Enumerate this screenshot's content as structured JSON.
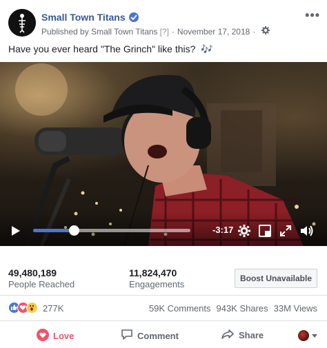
{
  "post": {
    "page_name": "Small Town Titans",
    "published_prefix": "Published by",
    "published_page": "Small Town Titans",
    "published_q": "[?]",
    "separator": "·",
    "date": "November 17, 2018",
    "more_label": "•••",
    "caption": "Have you ever heard \"The Grinch\" like this?",
    "caption_emoji": "🎶"
  },
  "video": {
    "time_remaining": "-3:17",
    "progress_fraction": 0.26
  },
  "stats": {
    "reach_value": "49,480,189",
    "reach_label": "People Reached",
    "engagements_value": "11,824,470",
    "engagements_label": "Engagements",
    "boost_label": "Boost Unavailable"
  },
  "reactions": {
    "count": "277K",
    "comments": "59K Comments",
    "shares": "943K Shares",
    "views": "33M Views"
  },
  "actions": {
    "love_label": "Love",
    "comment_label": "Comment",
    "share_label": "Share"
  },
  "icons": {
    "verified": "verified-check-icon",
    "gear": "gear-icon",
    "play": "play-icon",
    "settings": "settings-icon",
    "pip": "picture-in-picture-icon",
    "fullscreen": "fullscreen-icon",
    "volume": "volume-icon",
    "love": "heart-icon",
    "comment": "comment-bubble-icon",
    "share": "share-arrow-icon",
    "dropdown": "caret-down-icon"
  },
  "colors": {
    "link_blue": "#365899",
    "love_red": "#f25268",
    "progress_blue": "#4a76d3"
  }
}
